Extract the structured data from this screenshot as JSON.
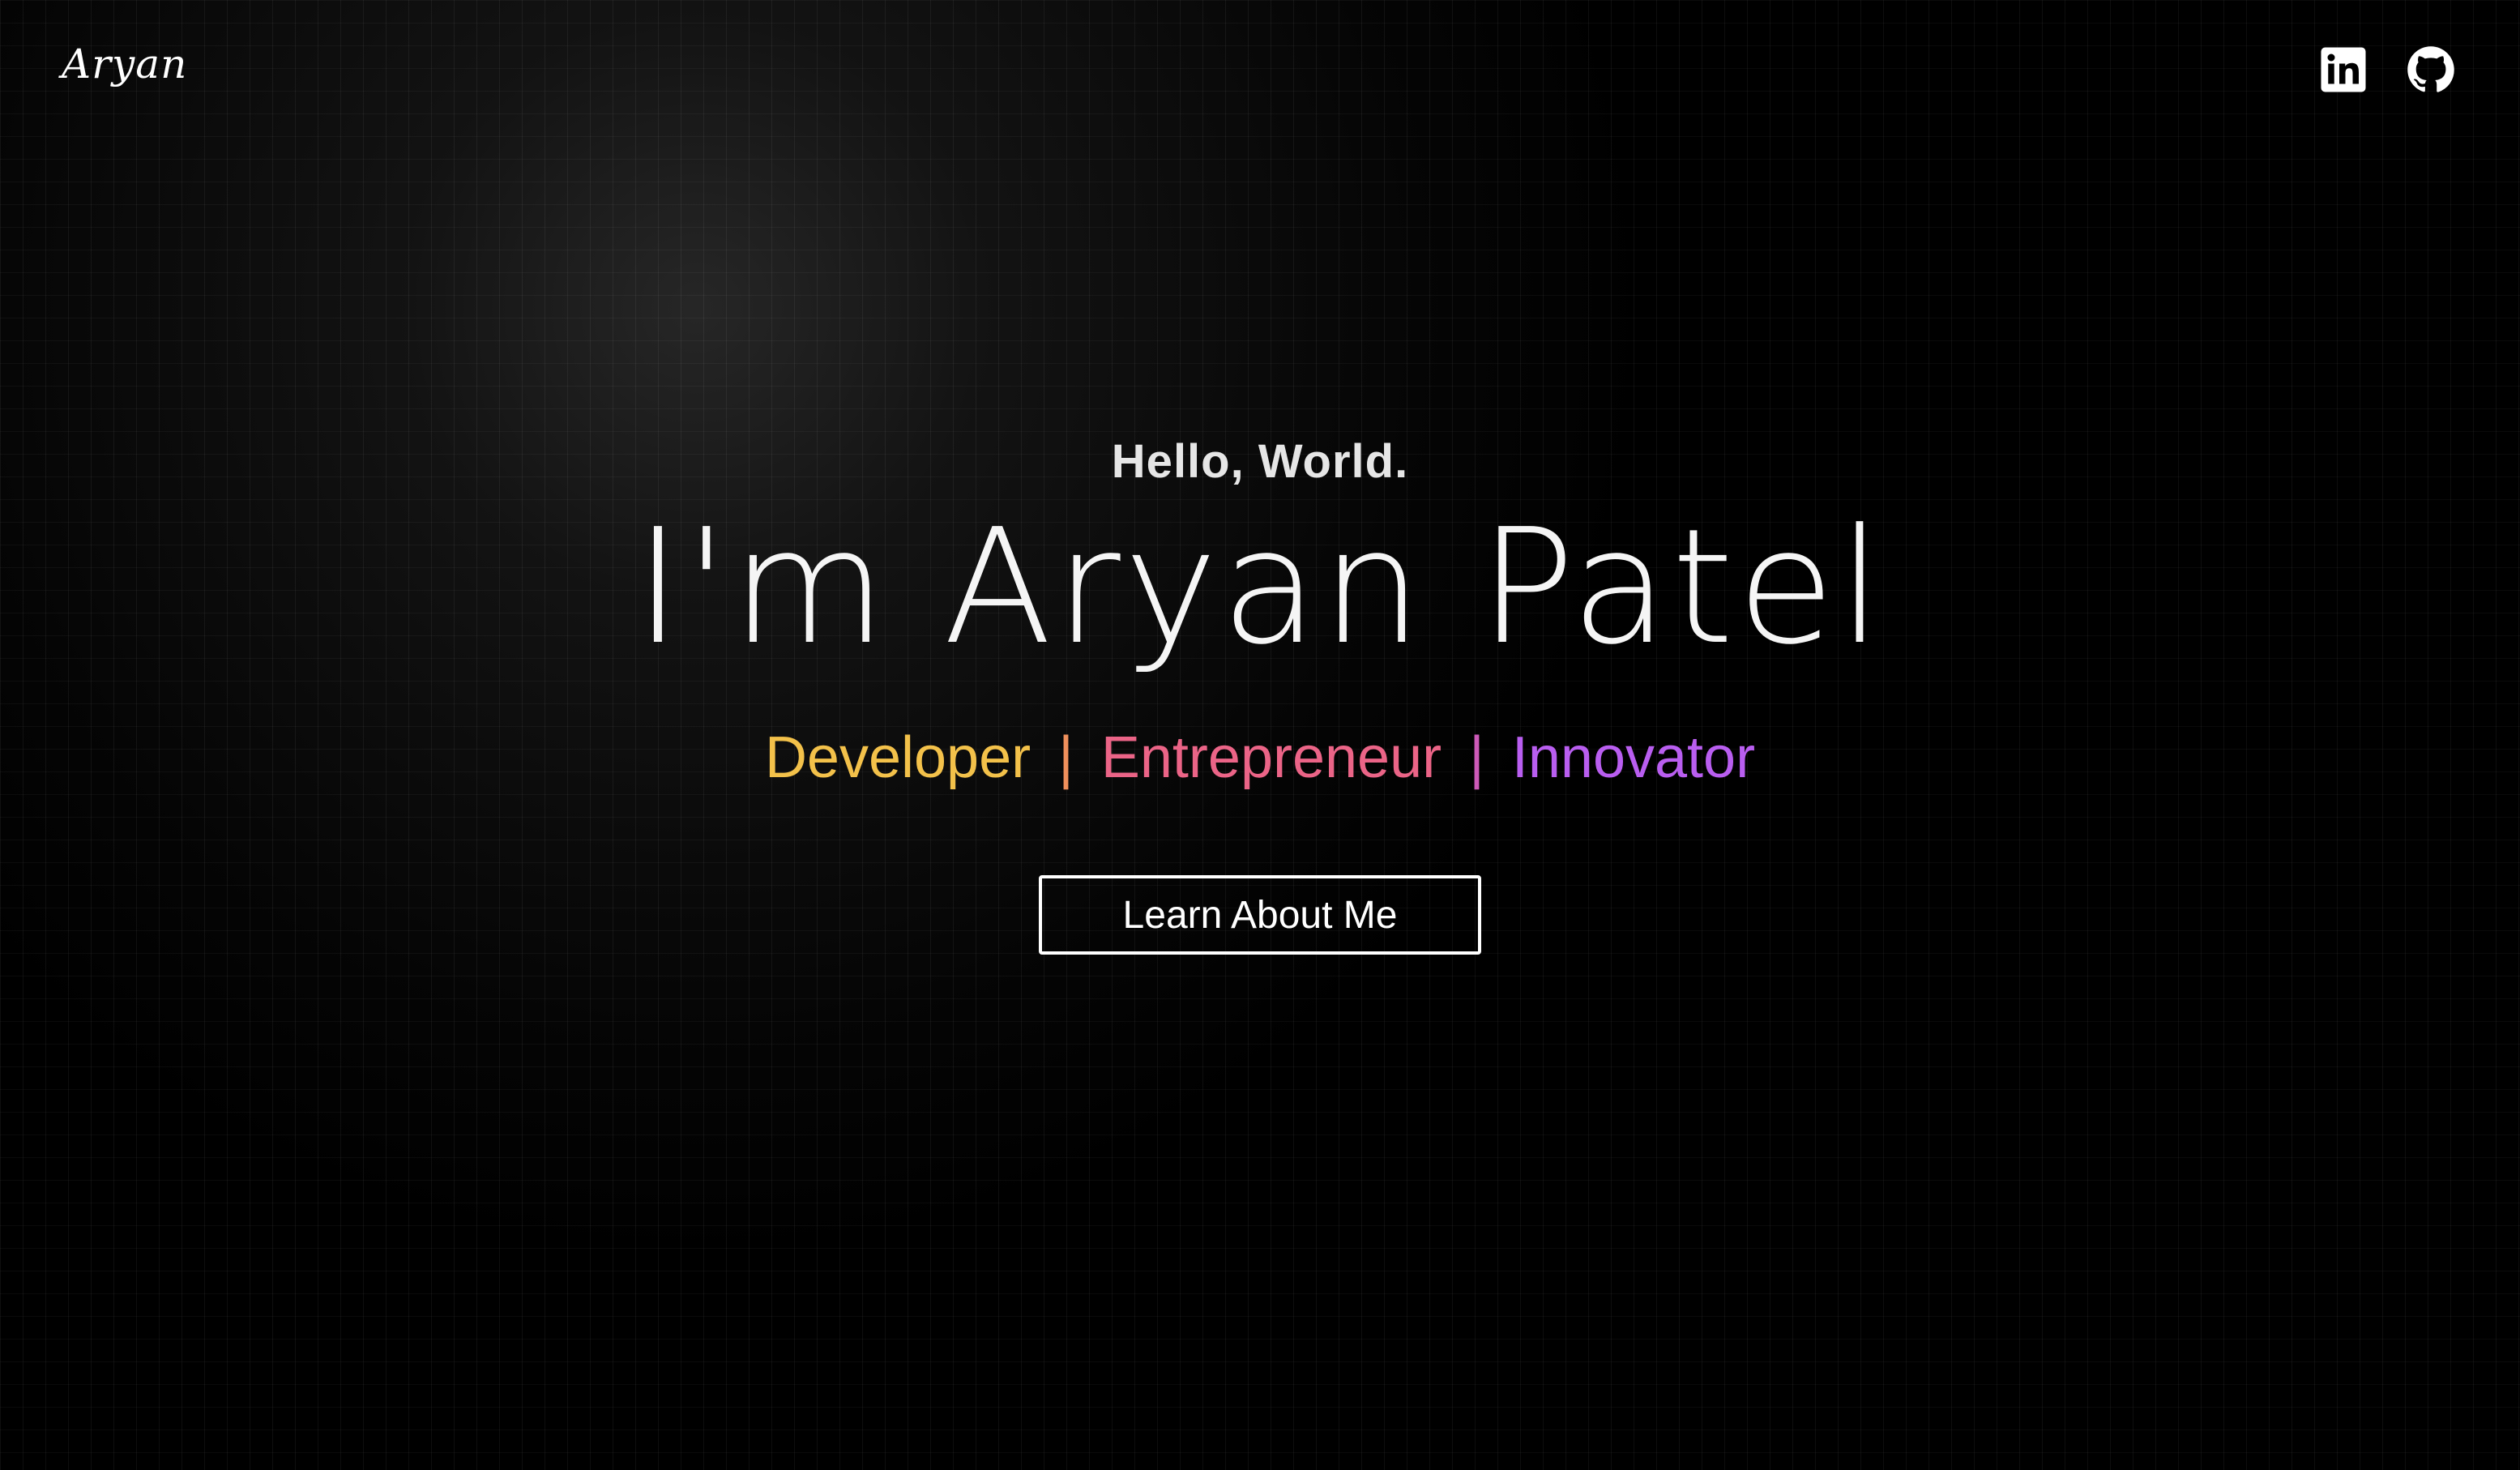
{
  "header": {
    "logo_text": "Aryan",
    "social": [
      {
        "name": "linkedin-icon"
      },
      {
        "name": "github-icon"
      }
    ]
  },
  "hero": {
    "greeting": "Hello, World.",
    "name": "I'm Aryan Patel",
    "roles": [
      "Developer",
      "Entrepreneur",
      "Innovator"
    ],
    "separator": "|",
    "cta_label": "Learn About Me"
  },
  "colors": {
    "background": "#000000",
    "role_developer": "#f3c14a",
    "role_entrepreneur": "#eb6487",
    "role_innovator": "#b95ef0"
  }
}
